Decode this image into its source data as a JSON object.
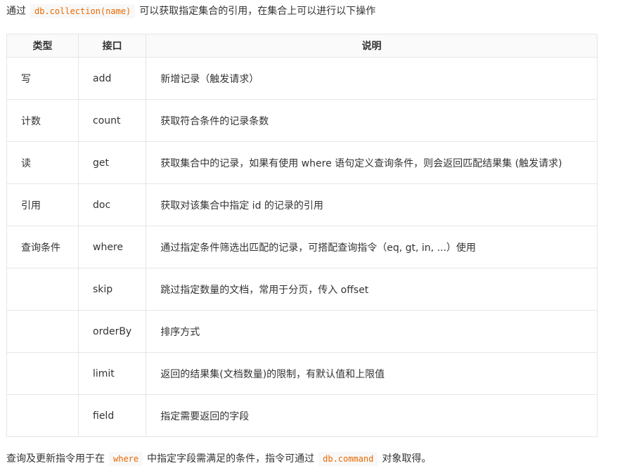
{
  "intro": {
    "prefix": "通过",
    "code": "db.collection(name)",
    "suffix": "可以获取指定集合的引用，在集合上可以进行以下操作"
  },
  "table": {
    "headers": [
      "类型",
      "接口",
      "说明"
    ],
    "rows": [
      {
        "type": "写",
        "api": "add",
        "desc": "新增记录（触发请求）"
      },
      {
        "type": "计数",
        "api": "count",
        "desc": "获取符合条件的记录条数"
      },
      {
        "type": "读",
        "api": "get",
        "desc": "获取集合中的记录，如果有使用 where 语句定义查询条件，则会返回匹配结果集 (触发请求)"
      },
      {
        "type": "引用",
        "api": "doc",
        "desc": "获取对该集合中指定 id 的记录的引用"
      },
      {
        "type": "查询条件",
        "api": "where",
        "desc": "通过指定条件筛选出匹配的记录，可搭配查询指令（eq, gt, in, ...）使用"
      },
      {
        "type": "",
        "api": "skip",
        "desc": "跳过指定数量的文档，常用于分页，传入 offset"
      },
      {
        "type": "",
        "api": "orderBy",
        "desc": "排序方式"
      },
      {
        "type": "",
        "api": "limit",
        "desc": "返回的结果集(文档数量)的限制，有默认值和上限值"
      },
      {
        "type": "",
        "api": "field",
        "desc": "指定需要返回的字段"
      }
    ]
  },
  "outro": {
    "part1": "查询及更新指令用于在",
    "code1": "where",
    "part2": "中指定字段需满足的条件，指令可通过",
    "code2": "db.command",
    "part3": "对象取得。"
  }
}
